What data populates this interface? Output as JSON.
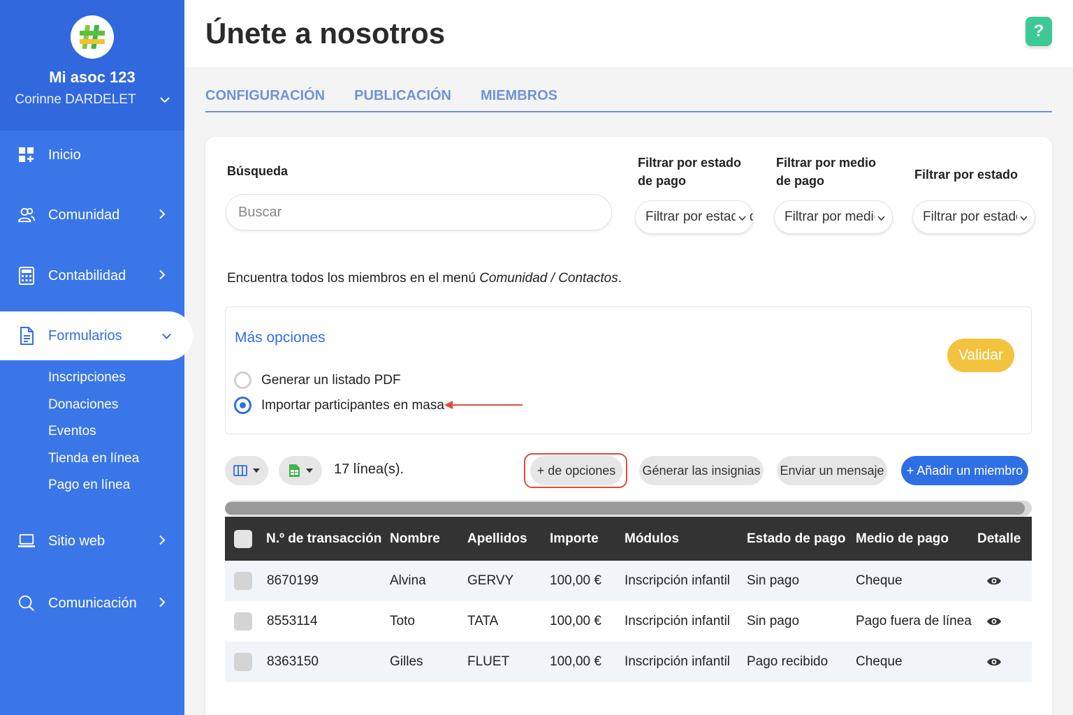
{
  "sidebar": {
    "org_name": "Mi asoc 123",
    "user_name": "Corinne DARDELET",
    "nav": {
      "inicio": "Inicio",
      "comunidad": "Comunidad",
      "contabilidad": "Contabilidad",
      "formularios": "Formularios",
      "sitio_web": "Sitio web",
      "comunicacion": "Comunicación"
    },
    "subitems": [
      "Inscripciones",
      "Donaciones",
      "Eventos",
      "Tienda en línea",
      "Pago en línea"
    ]
  },
  "header": {
    "title": "Únete a nosotros",
    "help": "?"
  },
  "tabs": [
    "CONFIGURACIÓN",
    "PUBLICACIÓN",
    "MIEMBROS"
  ],
  "filters": {
    "search_label": "Búsqueda",
    "search_placeholder": "Buscar",
    "payment_status_label_1": "Filtrar por estado",
    "payment_status_label_2": "de pago",
    "payment_status_value": "Filtrar por estado de pago",
    "payment_method_label_1": "Filtrar por medio",
    "payment_method_label_2": "de pago",
    "payment_method_value": "Filtrar por medio",
    "status_label": "Filtrar por estado",
    "status_value": "Filtrar por estado"
  },
  "info": {
    "prefix": "Encuentra todos los miembros en el menú ",
    "emphasis": "Comunidad / Contactos",
    "suffix": "."
  },
  "options": {
    "title": "Más opciones",
    "radio_pdf": "Generar un listado PDF",
    "radio_import": "Importar participantes en masa",
    "selected": "radio_import",
    "validate": "Validar"
  },
  "toolbar": {
    "line_count": "17 línea(s).",
    "more_options": "+ de opciones",
    "badges": "Génerar las insignias",
    "message": "Enviar un mensaje",
    "add_member": "+ Añadir un miembro"
  },
  "table": {
    "headers": [
      "N.º de transacción",
      "Nombre",
      "Apellidos",
      "Importe",
      "Módulos",
      "Estado de pago",
      "Medio de pago",
      "Detalle"
    ],
    "rows": [
      [
        "8670199",
        "Alvina",
        "GERVY",
        "100,00 €",
        "Inscripción infantil",
        "Sin pago",
        "Cheque"
      ],
      [
        "8553114",
        "Toto",
        "TATA",
        "100,00 €",
        "Inscripción infantil",
        "Sin pago",
        "Pago fuera de línea"
      ],
      [
        "8363150",
        "Gilles",
        "FLUET",
        "100,00 €",
        "Inscripción infantil",
        "Pago recibido",
        "Cheque"
      ]
    ]
  },
  "colors": {
    "sidebar": "#3a76e8",
    "primary": "#2f6fe4",
    "validate": "#f3c33f",
    "help": "#3cc996",
    "highlight": "#e14a3a",
    "table_header": "#333333"
  },
  "icons": {
    "logo": "hashtag-logo",
    "inicio": "dashboard-icon",
    "comunidad": "users-icon",
    "contabilidad": "calculator-icon",
    "formularios": "document-icon",
    "sitio_web": "laptop-icon",
    "comunicacion": "chat-icon",
    "detail": "eye-icon"
  }
}
